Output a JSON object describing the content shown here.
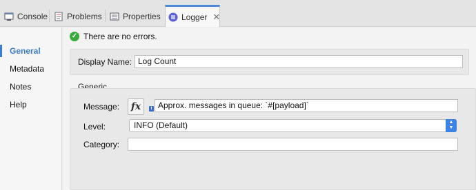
{
  "tabs": [
    {
      "label": "Console",
      "icon": "console-icon"
    },
    {
      "label": "Problems",
      "icon": "problems-icon"
    },
    {
      "label": "Properties",
      "icon": "properties-icon"
    },
    {
      "label": "Logger",
      "icon": "logger-icon",
      "active": true
    }
  ],
  "nav": {
    "items": [
      "General",
      "Metadata",
      "Notes",
      "Help"
    ],
    "active": "General"
  },
  "status": {
    "text": "There are no errors."
  },
  "display_name": {
    "label": "Display Name:",
    "value": "Log Count"
  },
  "generic": {
    "title": "Generic",
    "message": {
      "label": "Message:",
      "fx_label": "fx",
      "value": "Approx. messages in queue: `#[payload]`"
    },
    "level": {
      "label": "Level:",
      "value": "INFO (Default)"
    },
    "category": {
      "label": "Category:",
      "value": ""
    }
  },
  "colors": {
    "accent": "#3a7bd5",
    "ok": "#3aaa3a",
    "select_button": "#3d82e6"
  }
}
